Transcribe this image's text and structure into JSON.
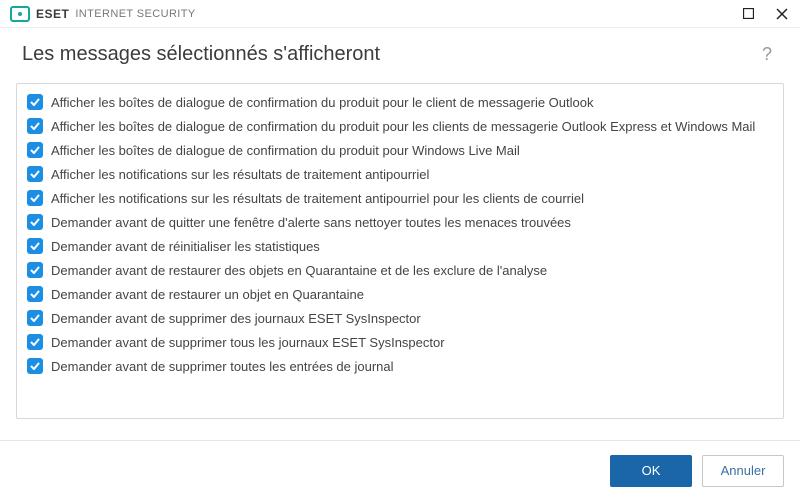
{
  "titlebar": {
    "brand_eset": "ESET",
    "brand_product": "INTERNET SECURITY"
  },
  "header": {
    "title": "Les messages sélectionnés s'afficheront",
    "help_label": "?"
  },
  "list": {
    "items": [
      {
        "checked": true,
        "label": "Afficher les boîtes de dialogue de confirmation du produit pour le client de messagerie Outlook"
      },
      {
        "checked": true,
        "label": "Afficher les boîtes de dialogue de confirmation du produit pour les clients de messagerie Outlook Express et Windows Mail"
      },
      {
        "checked": true,
        "label": "Afficher les boîtes de dialogue de confirmation du produit pour Windows Live Mail"
      },
      {
        "checked": true,
        "label": "Afficher les notifications sur les résultats de traitement antipourriel"
      },
      {
        "checked": true,
        "label": "Afficher les notifications sur les résultats de traitement antipourriel pour les clients de courriel"
      },
      {
        "checked": true,
        "label": "Demander avant de quitter une fenêtre d'alerte sans nettoyer toutes les menaces trouvées"
      },
      {
        "checked": true,
        "label": "Demander avant de réinitialiser les statistiques"
      },
      {
        "checked": true,
        "label": "Demander avant de restaurer des objets en Quarantaine et de les exclure de l'analyse"
      },
      {
        "checked": true,
        "label": "Demander avant de restaurer un objet en Quarantaine"
      },
      {
        "checked": true,
        "label": "Demander avant de supprimer des journaux ESET SysInspector"
      },
      {
        "checked": true,
        "label": "Demander avant de supprimer tous les journaux ESET SysInspector"
      },
      {
        "checked": true,
        "label": "Demander avant de supprimer toutes les entrées de journal"
      }
    ]
  },
  "footer": {
    "ok_label": "OK",
    "cancel_label": "Annuler"
  }
}
